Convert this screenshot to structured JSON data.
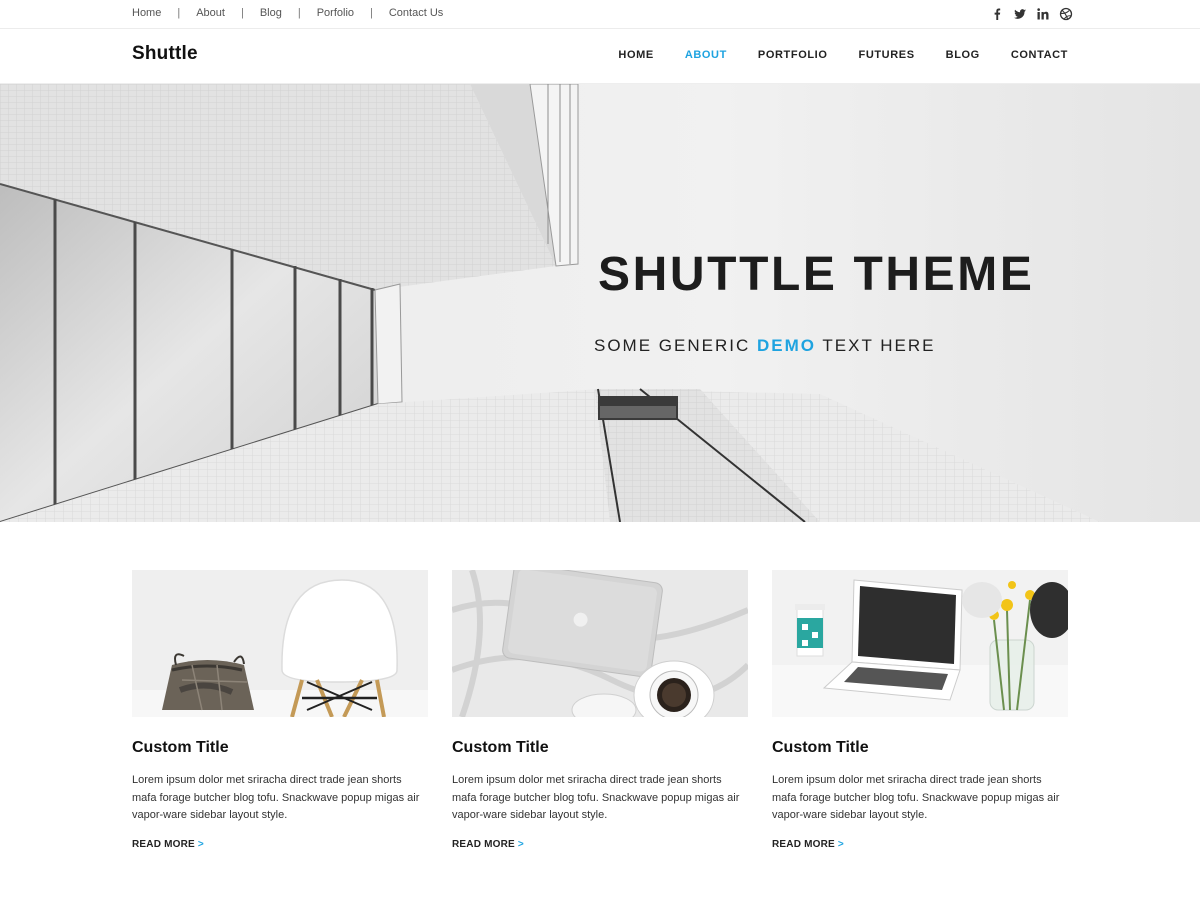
{
  "topbar": {
    "links": [
      "Home",
      "About",
      "Blog",
      "Porfolio",
      "Contact Us"
    ],
    "separator": "|",
    "socials": [
      "facebook-icon",
      "twitter-icon",
      "linkedin-icon",
      "dribbble-icon"
    ]
  },
  "header": {
    "logo": "Shuttle",
    "nav": [
      "HOME",
      "ABOUT",
      "PORTFOLIO",
      "FUTURES",
      "BLOG",
      "CONTACT"
    ],
    "active_nav": "ABOUT"
  },
  "hero": {
    "title": "SHUTTLE THEME",
    "subtitle_before": "SOME GENERIC",
    "subtitle_highlight": "DEMO",
    "subtitle_after": "TEXT HERE"
  },
  "cards": [
    {
      "image": "chair-basket-photo",
      "title": "Custom Title",
      "text": "Lorem ipsum dolor met sriracha direct trade jean shorts mafa forage butcher blog tofu. Snackwave popup migas air vapor-ware sidebar layout style.",
      "more": "READ MORE",
      "arrow": ">"
    },
    {
      "image": "laptop-coffee-bed-photo",
      "title": "Custom Title",
      "text": "Lorem ipsum dolor met sriracha direct trade jean shorts mafa forage butcher blog tofu. Snackwave popup migas air vapor-ware sidebar layout style.",
      "more": "READ MORE",
      "arrow": ">"
    },
    {
      "image": "laptop-flowers-desk-photo",
      "title": "Custom Title",
      "text": "Lorem ipsum dolor met sriracha direct trade jean shorts mafa forage butcher blog tofu. Snackwave popup migas air vapor-ware sidebar layout style.",
      "more": "READ MORE",
      "arrow": ">"
    }
  ],
  "colors": {
    "accent": "#1ea3e0",
    "text": "#222222",
    "hero_bg": "#eeeeee"
  }
}
